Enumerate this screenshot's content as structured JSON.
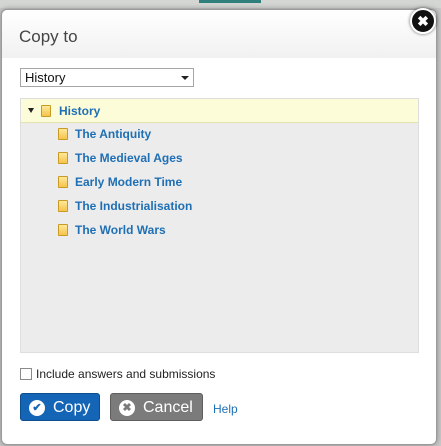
{
  "dialog": {
    "title": "Copy to",
    "close_icon": "close-icon",
    "close_glyph": "✖"
  },
  "selector": {
    "selected": "History"
  },
  "tree": {
    "root": {
      "label": "History",
      "icon": "folder-icon",
      "expanded": true
    },
    "children": [
      {
        "label": "The Antiquity",
        "icon": "folder-icon"
      },
      {
        "label": "The Medieval Ages",
        "icon": "folder-icon"
      },
      {
        "label": "Early Modern Time",
        "icon": "folder-icon"
      },
      {
        "label": "The Industrialisation",
        "icon": "folder-icon"
      },
      {
        "label": "The World Wars",
        "icon": "folder-icon"
      }
    ]
  },
  "options": {
    "include_label": "Include answers and submissions",
    "include_checked": false
  },
  "buttons": {
    "copy_label": "Copy",
    "copy_icon": "check-icon",
    "copy_glyph": "✔",
    "cancel_label": "Cancel",
    "cancel_icon": "x-icon",
    "cancel_glyph": "✖",
    "help_label": "Help"
  },
  "colors": {
    "primary": "#1565b6",
    "secondary": "#7b7b7b",
    "link": "#1f6fb4",
    "selected_row": "#fdfcd8"
  }
}
